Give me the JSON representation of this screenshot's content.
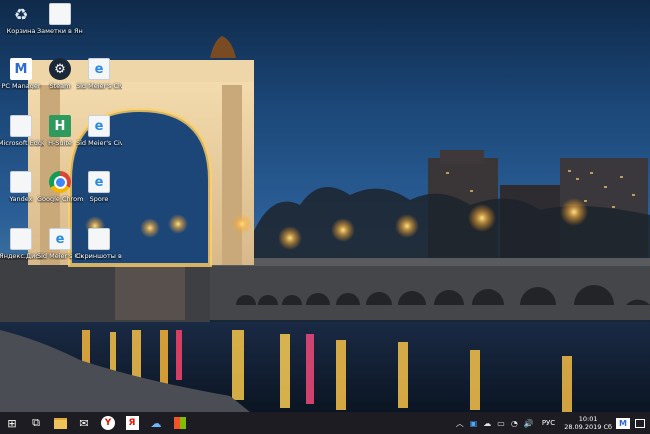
{
  "desktop_icons": [
    {
      "label": "Корзина",
      "icon": "recycle-bin-icon"
    },
    {
      "label": "Заметки в Яндекс.Дис...",
      "icon": "document-icon"
    },
    {
      "label": "PC Manager",
      "icon": "pc-manager-icon"
    },
    {
      "label": "Steam",
      "icon": "steam-icon"
    },
    {
      "label": "Sid Meier's Civilization VI",
      "icon": "ie-shortcut-icon"
    },
    {
      "label": "Microsoft Edge",
      "icon": "document-icon"
    },
    {
      "label": "H-Suite",
      "icon": "hsuite-icon"
    },
    {
      "label": "Sid Meier's Civilization V",
      "icon": "ie-shortcut-icon"
    },
    {
      "label": "Yandex",
      "icon": "document-icon"
    },
    {
      "label": "Google Chrome",
      "icon": "chrome-icon"
    },
    {
      "label": "Spore",
      "icon": "ie-shortcut-icon"
    },
    {
      "label": "Яндекс.Диск",
      "icon": "document-icon"
    },
    {
      "label": "Sid Meier's Civilization VI",
      "icon": "ie-shortcut-icon"
    },
    {
      "label": "Скриншоты в Яндекс.Д...",
      "icon": "document-icon"
    }
  ],
  "taskbar": {
    "pinned": [
      {
        "name": "start",
        "glyph": "⊞"
      },
      {
        "name": "task-view",
        "glyph": "⧉"
      },
      {
        "name": "file-explorer",
        "glyph": "▭"
      },
      {
        "name": "mail",
        "glyph": "✉"
      },
      {
        "name": "yandex-browser",
        "glyph": "Y"
      },
      {
        "name": "yandex-alt",
        "glyph": "Я"
      },
      {
        "name": "weather",
        "glyph": "☁"
      },
      {
        "name": "store",
        "glyph": "🛍"
      }
    ],
    "tray": {
      "language": "РУС",
      "time": "10:01",
      "date": "28.09.2019 Сб"
    }
  },
  "colors": {
    "taskbar_bg": "#1c1c22",
    "sky_top": "#0f2a4a",
    "sky_bottom": "#3a6d9c"
  }
}
